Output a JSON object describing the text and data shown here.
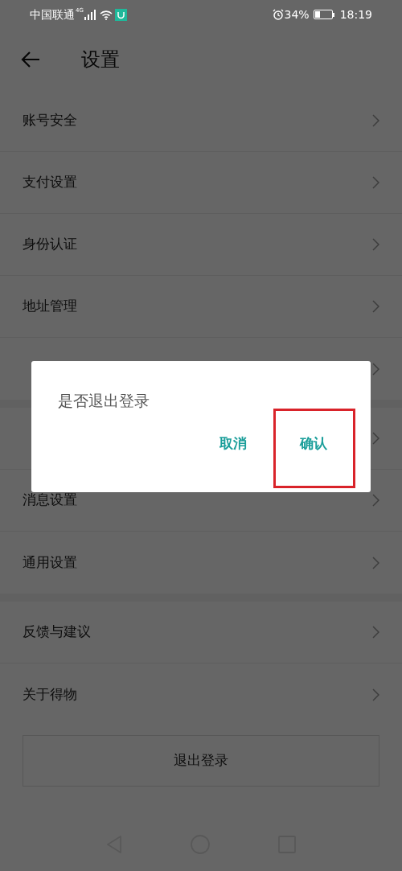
{
  "status_bar": {
    "carrier": "中国联通",
    "network": "4G",
    "battery": "34%",
    "time": "18:19"
  },
  "header": {
    "title": "设置"
  },
  "sections": [
    {
      "items": [
        {
          "label": "账号安全",
          "chevron": true
        },
        {
          "label": "支付设置",
          "chevron": true
        },
        {
          "label": "身份认证",
          "chevron": true
        },
        {
          "label": "地址管理",
          "chevron": true
        },
        {
          "chevron": true
        }
      ]
    },
    {
      "items": [
        {
          "chevron": true
        },
        {
          "label": "消息设置",
          "chevron": true
        },
        {
          "label": "通用设置",
          "chevron": true
        }
      ]
    },
    {
      "items": [
        {
          "label": "反馈与建议",
          "chevron": true
        },
        {
          "label": "关于得物",
          "chevron": true
        }
      ]
    }
  ],
  "logout_button": "退出登录",
  "dialog": {
    "message": "是否退出登录",
    "buttons": [
      {
        "label": "取消",
        "highlighted": false
      },
      {
        "label": "确认",
        "highlighted": true
      }
    ]
  }
}
